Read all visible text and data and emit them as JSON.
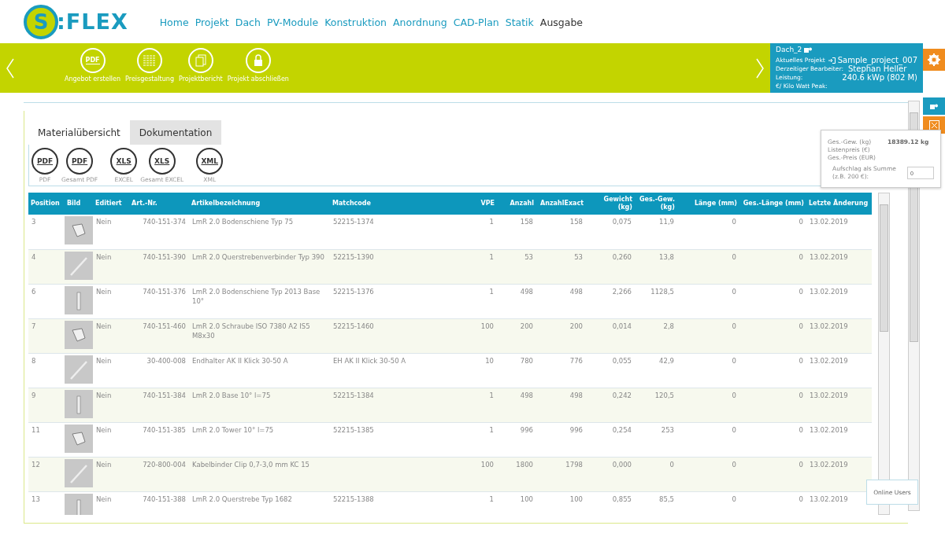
{
  "logo": {
    "mark": "S",
    "text": ":FLEX"
  },
  "nav": [
    {
      "label": "Home",
      "selected": false
    },
    {
      "label": "Projekt",
      "selected": false
    },
    {
      "label": "Dach",
      "selected": false
    },
    {
      "label": "PV-Module",
      "selected": false
    },
    {
      "label": "Konstruktion",
      "selected": false
    },
    {
      "label": "Anordnung",
      "selected": false
    },
    {
      "label": "CAD-Plan",
      "selected": false
    },
    {
      "label": "Statik",
      "selected": false
    },
    {
      "label": "Ausgabe",
      "selected": true
    }
  ],
  "actions": [
    {
      "kind": "pdf",
      "glyph": "PDF",
      "label": "Angebot erstellen"
    },
    {
      "kind": "list",
      "label": "Preisgestaltung"
    },
    {
      "kind": "docs",
      "label": "Projektbericht"
    },
    {
      "kind": "lock",
      "label": "Projekt abschließen"
    }
  ],
  "project_panel": {
    "roof": "Dach_2",
    "rows": [
      {
        "label": "Aktuelles Projekt",
        "value": "Sample_project_007"
      },
      {
        "label": "Derzeitiger Bearbeiter:",
        "value": "Stephan Heller"
      },
      {
        "label": "Leistung:",
        "value": "240.6 kWp (802 M)"
      },
      {
        "label": "€/ Kilo Watt Peak:"
      }
    ]
  },
  "tabs": [
    {
      "label": "Materialübersicht",
      "selected": true
    },
    {
      "label": "Dokumentation",
      "selected": false
    }
  ],
  "exports": [
    {
      "glyph": "PDF",
      "label": "PDF"
    },
    {
      "glyph": "PDF",
      "label": "Gesamt PDF"
    },
    {
      "glyph": "XLS",
      "label": "EXCEL"
    },
    {
      "glyph": "XLS",
      "label": "Gesamt EXCEL"
    },
    {
      "glyph": "XML",
      "label": "XML"
    }
  ],
  "table": {
    "columns": [
      "Position",
      "Bild",
      "Editiert",
      "Art.-Nr.",
      "Artikelbezeichnung",
      "Matchcode",
      "VPE",
      "Anzahl",
      "AnzahlExact",
      "Gewicht (kg)",
      "Ges.-Gew. (kg)",
      "Länge (mm)",
      "Ges.-Länge (mm)",
      "Letzte Änderung"
    ],
    "rows": [
      [
        "3",
        "",
        "Nein",
        "740-151-374",
        "LmR 2.0 Bodenschiene Typ 75",
        "52215-1374",
        "1",
        "158",
        "158",
        "0,075",
        "11,9",
        "0",
        "0",
        "13.02.2019"
      ],
      [
        "4",
        "",
        "Nein",
        "740-151-390",
        "LmR 2.0 Querstrebenverbinder Typ 390",
        "52215-1390",
        "1",
        "53",
        "53",
        "0,260",
        "13,8",
        "0",
        "0",
        "13.02.2019"
      ],
      [
        "6",
        "",
        "Nein",
        "740-151-376",
        "LmR 2.0 Bodenschiene Typ 2013 Base 10°",
        "52215-1376",
        "1",
        "498",
        "498",
        "2,266",
        "1128,5",
        "0",
        "0",
        "13.02.2019"
      ],
      [
        "7",
        "",
        "Nein",
        "740-151-460",
        "LmR 2.0 Schraube ISO 7380 A2 IS5 M8x30",
        "52215-1460",
        "100",
        "200",
        "200",
        "0,014",
        "2,8",
        "0",
        "0",
        "13.02.2019"
      ],
      [
        "8",
        "",
        "Nein",
        "30-400-008",
        "Endhalter AK II Klick 30-50 A",
        "EH AK II Klick 30-50 A",
        "10",
        "780",
        "776",
        "0,055",
        "42,9",
        "0",
        "0",
        "13.02.2019"
      ],
      [
        "9",
        "",
        "Nein",
        "740-151-384",
        "LmR 2.0 Base 10° l=75",
        "52215-1384",
        "1",
        "498",
        "498",
        "0,242",
        "120,5",
        "0",
        "0",
        "13.02.2019"
      ],
      [
        "11",
        "",
        "Nein",
        "740-151-385",
        "LmR 2.0 Tower 10° l=75",
        "52215-1385",
        "1",
        "996",
        "996",
        "0,254",
        "253",
        "0",
        "0",
        "13.02.2019"
      ],
      [
        "12",
        "",
        "Nein",
        "720-800-004",
        "Kabelbinder Clip 0,7-3,0 mm KC 15",
        "",
        "100",
        "1800",
        "1798",
        "0,000",
        "0",
        "0",
        "0",
        "13.02.2019"
      ],
      [
        "13",
        "",
        "Nein",
        "740-151-388",
        "LmR 2.0 Querstrebe Typ 1682",
        "52215-1388",
        "1",
        "100",
        "100",
        "0,855",
        "85,5",
        "0",
        "0",
        "13.02.2019"
      ]
    ]
  },
  "summary": {
    "rows": [
      {
        "label": "Ges.-Gew. (kg)",
        "value": "18389.12 kg"
      },
      {
        "label": "Listenpreis (€)"
      },
      {
        "label": "Ges.-Preis (EUR)"
      }
    ],
    "surcharge": {
      "label": "Aufschlag als Summe (z.B. 200 €):",
      "value": "0"
    }
  },
  "online_users": "Online Users"
}
